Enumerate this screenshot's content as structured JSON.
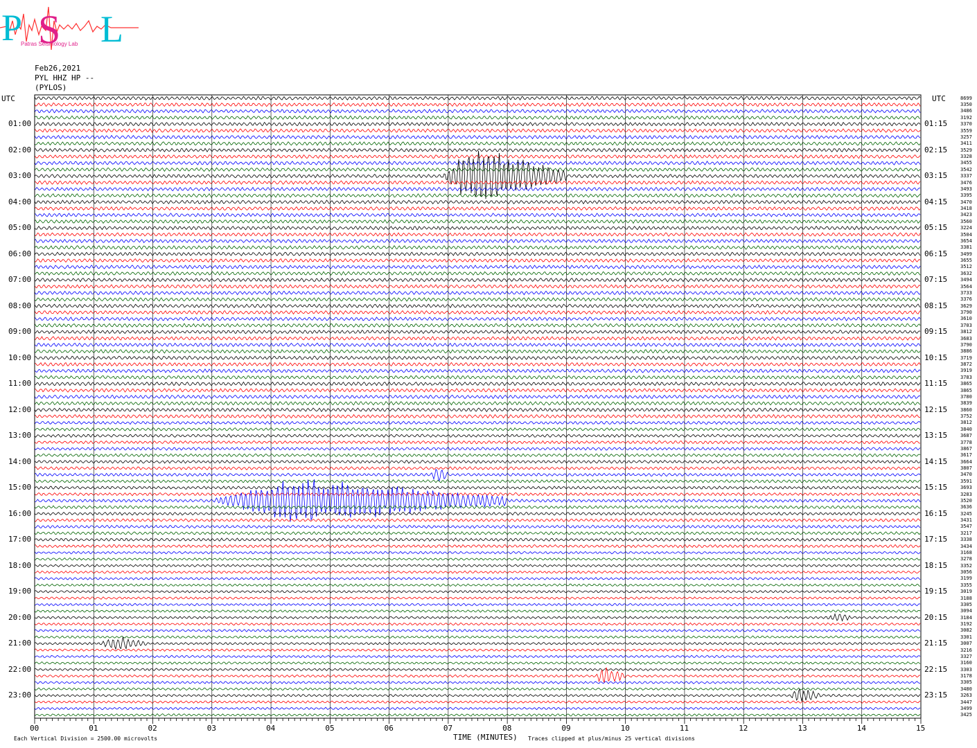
{
  "logo": {
    "letters": "PSL",
    "subtitle": "Patras Seismology Lab",
    "colors": {
      "cyan": "#00bcd4",
      "magenta": "#e0208a",
      "trace": "#ff3030"
    }
  },
  "header": {
    "date": "Feb26,2021",
    "channel": "PYL HHZ HP --",
    "station": "(PYLOS)"
  },
  "left_axis_label": "UTC",
  "right_axis_label": "UTC",
  "left_hours": [
    "01:00",
    "02:00",
    "03:00",
    "04:00",
    "05:00",
    "06:00",
    "07:00",
    "08:00",
    "09:00",
    "10:00",
    "11:00",
    "12:00",
    "13:00",
    "14:00",
    "15:00",
    "16:00",
    "17:00",
    "18:00",
    "19:00",
    "20:00",
    "21:00",
    "22:00",
    "23:00"
  ],
  "right_hours": [
    "01:15",
    "02:15",
    "03:15",
    "04:15",
    "05:15",
    "06:15",
    "07:15",
    "08:15",
    "09:15",
    "10:15",
    "11:15",
    "12:15",
    "13:15",
    "14:15",
    "15:15",
    "16:15",
    "17:15",
    "18:15",
    "19:15",
    "20:15",
    "21:15",
    "22:15",
    "23:15"
  ],
  "right_counts": [
    "8699",
    "3350",
    "3486",
    "3192",
    "3370",
    "3559",
    "3257",
    "3411",
    "3529",
    "3328",
    "3455",
    "3542",
    "3337",
    "3476",
    "3493",
    "3395",
    "3470",
    "3418",
    "3423",
    "3560",
    "3224",
    "3504",
    "3654",
    "3381",
    "3499",
    "3655",
    "3512",
    "3632",
    "3494",
    "3564",
    "3733",
    "3376",
    "3629",
    "3790",
    "3610",
    "3703",
    "3812",
    "3683",
    "3790",
    "3886",
    "3719",
    "3872",
    "3919",
    "3783",
    "3865",
    "3865",
    "3780",
    "3839",
    "3860",
    "3752",
    "3812",
    "3840",
    "3687",
    "3778",
    "3867",
    "3617",
    "3664",
    "3807",
    "3470",
    "3591",
    "3693",
    "3283",
    "3520",
    "3636",
    "3245",
    "3431",
    "3547",
    "3217",
    "3338",
    "3434",
    "3168",
    "3278",
    "3352",
    "3056",
    "3199",
    "3355",
    "3019",
    "3188",
    "3305",
    "3094",
    "3184",
    "3192",
    "3082",
    "3301",
    "3007",
    "3216",
    "3327",
    "3160",
    "3303",
    "3178",
    "3305",
    "3480",
    "3263",
    "3447",
    "3499",
    "3425"
  ],
  "chart_data": {
    "type": "line",
    "title": "",
    "xlabel": "TIME (MINUTES)",
    "x_ticks": [
      "00",
      "01",
      "02",
      "03",
      "04",
      "05",
      "06",
      "07",
      "08",
      "09",
      "10",
      "11",
      "12",
      "13",
      "14",
      "15"
    ],
    "xlim": [
      0,
      15
    ],
    "rows": 96,
    "minutes_per_row": 15,
    "trace_colors": [
      "#000000",
      "#ff0000",
      "#0000ff",
      "#006400"
    ],
    "events": [
      {
        "row": 12,
        "start_min": 6.9,
        "end_min": 9.0,
        "peak_min": 7.4,
        "amplitude": 4.5,
        "color": "#ff0000"
      },
      {
        "row": 62,
        "start_min": 3.0,
        "end_min": 8.0,
        "peak_min": 4.4,
        "amplitude": 3.5,
        "color": "#006400"
      },
      {
        "row": 58,
        "start_min": 6.7,
        "end_min": 7.0,
        "peak_min": 6.85,
        "amplitude": 1.2,
        "color": "#0000ff"
      },
      {
        "row": 84,
        "start_min": 1.1,
        "end_min": 1.9,
        "peak_min": 1.4,
        "amplitude": 1.0,
        "color": "#0000ff"
      },
      {
        "row": 89,
        "start_min": 9.5,
        "end_min": 10.0,
        "peak_min": 9.6,
        "amplitude": 1.6,
        "color": "#ff0000"
      },
      {
        "row": 80,
        "start_min": 13.4,
        "end_min": 13.8,
        "peak_min": 13.6,
        "amplitude": 0.7,
        "color": "#000000"
      },
      {
        "row": 92,
        "start_min": 12.8,
        "end_min": 13.3,
        "peak_min": 12.9,
        "amplitude": 1.2,
        "color": "#000000"
      }
    ],
    "grid": true
  },
  "footer": {
    "left_note": "Each Vertical Division = 2500.00 microvolts",
    "right_note": "Traces clipped at plus/minus 25 vertical divisions"
  }
}
